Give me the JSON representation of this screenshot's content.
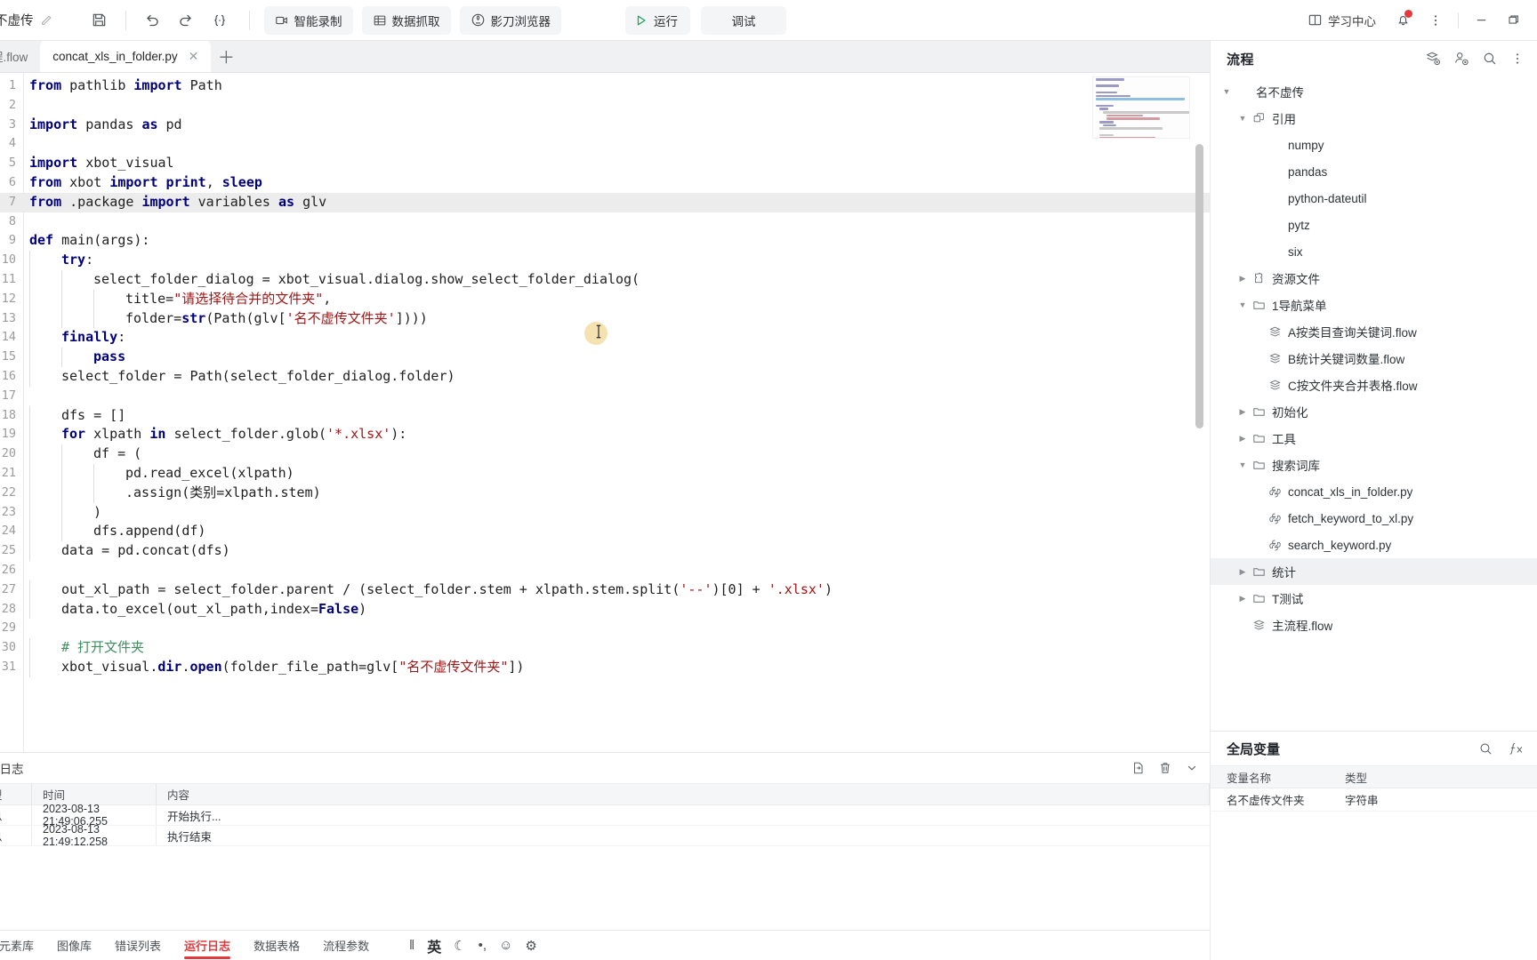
{
  "toolbar": {
    "project_name": "不虚传",
    "edit_icon": "pencil-icon",
    "save_icon": "save-icon",
    "undo_icon": "undo-icon",
    "redo_icon": "redo-icon",
    "format_icon": "format-code-icon",
    "buttons": [
      {
        "label": "智能录制",
        "icon": "camera-record-icon"
      },
      {
        "label": "数据抓取",
        "icon": "table-grab-icon"
      },
      {
        "label": "影刀浏览器",
        "icon": "browser-shield-icon"
      }
    ],
    "run_label": "运行",
    "run_icon": "play-icon",
    "debug_label": "调试",
    "learn_center_label": "学习中心",
    "learn_center_icon": "book-icon",
    "notification_icon": "bell-icon",
    "more_icon": "more-vertical-icon",
    "minimize_icon": "minimize-icon",
    "maximize_icon": "maximize-icon"
  },
  "tabs": {
    "inactive": {
      "label": "程.flow"
    },
    "active": {
      "label": "concat_xls_in_folder.py",
      "close_icon": "close-icon"
    },
    "add_icon": "plus-icon"
  },
  "editor": {
    "lines": [
      {
        "n": "1",
        "indent": 0,
        "tokens": [
          {
            "t": "from ",
            "c": "k"
          },
          {
            "t": "pathlib ",
            "c": "nm"
          },
          {
            "t": "import ",
            "c": "k"
          },
          {
            "t": "Path",
            "c": "nm"
          }
        ]
      },
      {
        "n": "2",
        "indent": 0,
        "tokens": []
      },
      {
        "n": "3",
        "indent": 0,
        "tokens": [
          {
            "t": "import ",
            "c": "k"
          },
          {
            "t": "pandas ",
            "c": "nm"
          },
          {
            "t": "as ",
            "c": "k"
          },
          {
            "t": "pd",
            "c": "nm"
          }
        ]
      },
      {
        "n": "4",
        "indent": 0,
        "tokens": []
      },
      {
        "n": "5",
        "indent": 0,
        "tokens": [
          {
            "t": "import ",
            "c": "k"
          },
          {
            "t": "xbot_visual",
            "c": "nm"
          }
        ]
      },
      {
        "n": "6",
        "indent": 0,
        "tokens": [
          {
            "t": "from ",
            "c": "k"
          },
          {
            "t": "xbot ",
            "c": "nm"
          },
          {
            "t": "import ",
            "c": "k"
          },
          {
            "t": "print",
            "c": "k"
          },
          {
            "t": ", ",
            "c": "nm"
          },
          {
            "t": "sleep",
            "c": "k"
          }
        ]
      },
      {
        "n": "7",
        "indent": 0,
        "hl": true,
        "tokens": [
          {
            "t": "from ",
            "c": "k"
          },
          {
            "t": ".package ",
            "c": "nm"
          },
          {
            "t": "import ",
            "c": "k"
          },
          {
            "t": "variables ",
            "c": "nm"
          },
          {
            "t": "as ",
            "c": "k"
          },
          {
            "t": "glv",
            "c": "nm"
          }
        ]
      },
      {
        "n": "8",
        "indent": 0,
        "tokens": []
      },
      {
        "n": "9",
        "indent": 0,
        "tokens": [
          {
            "t": "def ",
            "c": "k"
          },
          {
            "t": "main(args):",
            "c": "nm"
          }
        ]
      },
      {
        "n": "10",
        "indent": 1,
        "tokens": [
          {
            "t": "try",
            "c": "k"
          },
          {
            "t": ":",
            "c": "nm"
          }
        ]
      },
      {
        "n": "11",
        "indent": 2,
        "tokens": [
          {
            "t": "select_folder_dialog = xbot_visual.dialog.show_select_folder_dialog(",
            "c": "nm"
          }
        ]
      },
      {
        "n": "12",
        "indent": 3,
        "tokens": [
          {
            "t": "title=",
            "c": "nm"
          },
          {
            "t": "\"请选择待合并的文件夹\"",
            "c": "s"
          },
          {
            "t": ",",
            "c": "nm"
          }
        ]
      },
      {
        "n": "13",
        "indent": 3,
        "tokens": [
          {
            "t": "folder=",
            "c": "nm"
          },
          {
            "t": "str",
            "c": "k"
          },
          {
            "t": "(Path(glv[",
            "c": "nm"
          },
          {
            "t": "'名不虚传文件夹'",
            "c": "s"
          },
          {
            "t": "])))",
            "c": "nm"
          }
        ]
      },
      {
        "n": "14",
        "indent": 1,
        "tokens": [
          {
            "t": "finally",
            "c": "k"
          },
          {
            "t": ":",
            "c": "nm"
          }
        ]
      },
      {
        "n": "15",
        "indent": 2,
        "tokens": [
          {
            "t": "pass",
            "c": "k"
          }
        ]
      },
      {
        "n": "16",
        "indent": 1,
        "tokens": [
          {
            "t": "select_folder = Path(select_folder_dialog.folder)",
            "c": "nm"
          }
        ]
      },
      {
        "n": "17",
        "indent": 0,
        "tokens": []
      },
      {
        "n": "18",
        "indent": 1,
        "tokens": [
          {
            "t": "dfs = []",
            "c": "nm"
          }
        ]
      },
      {
        "n": "19",
        "indent": 1,
        "tokens": [
          {
            "t": "for ",
            "c": "k"
          },
          {
            "t": "xlpath ",
            "c": "nm"
          },
          {
            "t": "in ",
            "c": "k"
          },
          {
            "t": "select_folder.glob(",
            "c": "nm"
          },
          {
            "t": "'*.xlsx'",
            "c": "s"
          },
          {
            "t": "):",
            "c": "nm"
          }
        ]
      },
      {
        "n": "20",
        "indent": 2,
        "tokens": [
          {
            "t": "df = (",
            "c": "nm"
          }
        ]
      },
      {
        "n": "21",
        "indent": 3,
        "tokens": [
          {
            "t": "pd.read_excel(xlpath)",
            "c": "nm"
          }
        ]
      },
      {
        "n": "22",
        "indent": 3,
        "tokens": [
          {
            "t": ".assign(类别=xlpath.stem)",
            "c": "nm"
          }
        ]
      },
      {
        "n": "23",
        "indent": 2,
        "tokens": [
          {
            "t": ")",
            "c": "nm"
          }
        ]
      },
      {
        "n": "24",
        "indent": 2,
        "tokens": [
          {
            "t": "dfs.append(df)",
            "c": "nm"
          }
        ]
      },
      {
        "n": "25",
        "indent": 1,
        "tokens": [
          {
            "t": "data = pd.concat(dfs)",
            "c": "nm"
          }
        ]
      },
      {
        "n": "26",
        "indent": 0,
        "tokens": []
      },
      {
        "n": "27",
        "indent": 1,
        "tokens": [
          {
            "t": "out_xl_path = select_folder.parent / (select_folder.stem + xlpath.stem.split(",
            "c": "nm"
          },
          {
            "t": "'--'",
            "c": "s"
          },
          {
            "t": ")[0] + ",
            "c": "nm"
          },
          {
            "t": "'.xlsx'",
            "c": "s"
          },
          {
            "t": ")",
            "c": "nm"
          }
        ]
      },
      {
        "n": "28",
        "indent": 1,
        "tokens": [
          {
            "t": "data.to_excel(out_xl_path,index=",
            "c": "nm"
          },
          {
            "t": "False",
            "c": "k"
          },
          {
            "t": ")",
            "c": "nm"
          }
        ]
      },
      {
        "n": "29",
        "indent": 0,
        "tokens": []
      },
      {
        "n": "30",
        "indent": 1,
        "tokens": [
          {
            "t": "# 打开文件夹",
            "c": "cm"
          }
        ]
      },
      {
        "n": "31",
        "indent": 1,
        "tokens": [
          {
            "t": "xbot_visual.",
            "c": "nm"
          },
          {
            "t": "dir",
            "c": "k"
          },
          {
            "t": ".",
            "c": "nm"
          },
          {
            "t": "open",
            "c": "k"
          },
          {
            "t": "(folder_file_path=glv[",
            "c": "nm"
          },
          {
            "t": "\"名不虚传文件夹\"",
            "c": "s"
          },
          {
            "t": "])",
            "c": "nm"
          }
        ]
      }
    ]
  },
  "log_panel": {
    "title": "行日志",
    "export_icon": "export-icon",
    "clear_icon": "trash-icon",
    "collapse_icon": "chevron-down-icon",
    "columns": [
      "型",
      "时间",
      "内容"
    ],
    "rows": [
      {
        "type": "息",
        "time": "2023-08-13 21:49:06.255",
        "content": "开始执行..."
      },
      {
        "type": "息",
        "time": "2023-08-13 21:49:12.258",
        "content": "执行结束"
      }
    ]
  },
  "status_bar": {
    "tabs": [
      {
        "label": "元素库",
        "active": false
      },
      {
        "label": "图像库",
        "active": false
      },
      {
        "label": "错误列表",
        "active": false
      },
      {
        "label": "运行日志",
        "active": true
      },
      {
        "label": "数据表格",
        "active": false
      },
      {
        "label": "流程参数",
        "active": false
      }
    ],
    "center_icons": [
      {
        "name": "pause-bars-icon",
        "glyph": "‖"
      },
      {
        "name": "ime-chinese-icon",
        "glyph": "英"
      },
      {
        "name": "moon-icon",
        "glyph": "☾"
      },
      {
        "name": "punctuation-icon",
        "glyph": "•,"
      },
      {
        "name": "emoji-icon",
        "glyph": "☺"
      },
      {
        "name": "gear-icon",
        "glyph": "⚙"
      }
    ]
  },
  "flow_panel": {
    "title": "流程",
    "actions": [
      {
        "name": "add-flow-icon"
      },
      {
        "name": "add-group-icon"
      },
      {
        "name": "search-icon"
      },
      {
        "name": "more-vertical-icon"
      }
    ],
    "tree": [
      {
        "label": "名不虚传",
        "depth": 0,
        "twisty": "down",
        "icon": "none",
        "selected": false
      },
      {
        "label": "引用",
        "depth": 1,
        "twisty": "down",
        "icon": "package",
        "selected": false
      },
      {
        "label": "numpy",
        "depth": 2,
        "twisty": "none",
        "icon": "none",
        "selected": false
      },
      {
        "label": "pandas",
        "depth": 2,
        "twisty": "none",
        "icon": "none",
        "selected": false
      },
      {
        "label": "python-dateutil",
        "depth": 2,
        "twisty": "none",
        "icon": "none",
        "selected": false
      },
      {
        "label": "pytz",
        "depth": 2,
        "twisty": "none",
        "icon": "none",
        "selected": false
      },
      {
        "label": "six",
        "depth": 2,
        "twisty": "none",
        "icon": "none",
        "selected": false
      },
      {
        "label": "资源文件",
        "depth": 1,
        "twisty": "right",
        "icon": "puzzle",
        "selected": false
      },
      {
        "label": "1导航菜单",
        "depth": 1,
        "twisty": "down",
        "icon": "folder",
        "selected": false
      },
      {
        "label": "A按类目查询关键词.flow",
        "depth": 2,
        "twisty": "none",
        "icon": "flow",
        "selected": false
      },
      {
        "label": "B统计关键词数量.flow",
        "depth": 2,
        "twisty": "none",
        "icon": "flow",
        "selected": false
      },
      {
        "label": "C按文件夹合并表格.flow",
        "depth": 2,
        "twisty": "none",
        "icon": "flow",
        "selected": false
      },
      {
        "label": "初始化",
        "depth": 1,
        "twisty": "right",
        "icon": "folder",
        "selected": false
      },
      {
        "label": "工具",
        "depth": 1,
        "twisty": "right",
        "icon": "folder",
        "selected": false
      },
      {
        "label": "搜索词库",
        "depth": 1,
        "twisty": "down",
        "icon": "folder",
        "selected": false
      },
      {
        "label": "concat_xls_in_folder.py",
        "depth": 2,
        "twisty": "none",
        "icon": "python",
        "selected": false
      },
      {
        "label": "fetch_keyword_to_xl.py",
        "depth": 2,
        "twisty": "none",
        "icon": "python",
        "selected": false
      },
      {
        "label": "search_keyword.py",
        "depth": 2,
        "twisty": "none",
        "icon": "python",
        "selected": false
      },
      {
        "label": "统计",
        "depth": 1,
        "twisty": "right",
        "icon": "folder",
        "selected": true
      },
      {
        "label": "T测试",
        "depth": 1,
        "twisty": "right",
        "icon": "folder",
        "selected": false
      },
      {
        "label": "主流程.flow",
        "depth": 1,
        "twisty": "none",
        "icon": "flow",
        "selected": false
      }
    ]
  },
  "global_vars": {
    "title": "全局变量",
    "search_icon": "search-icon",
    "fx_icon": "fx-icon",
    "columns": [
      "变量名称",
      "类型"
    ],
    "rows": [
      {
        "name": "名不虚传文件夹",
        "type": "字符串"
      }
    ]
  }
}
